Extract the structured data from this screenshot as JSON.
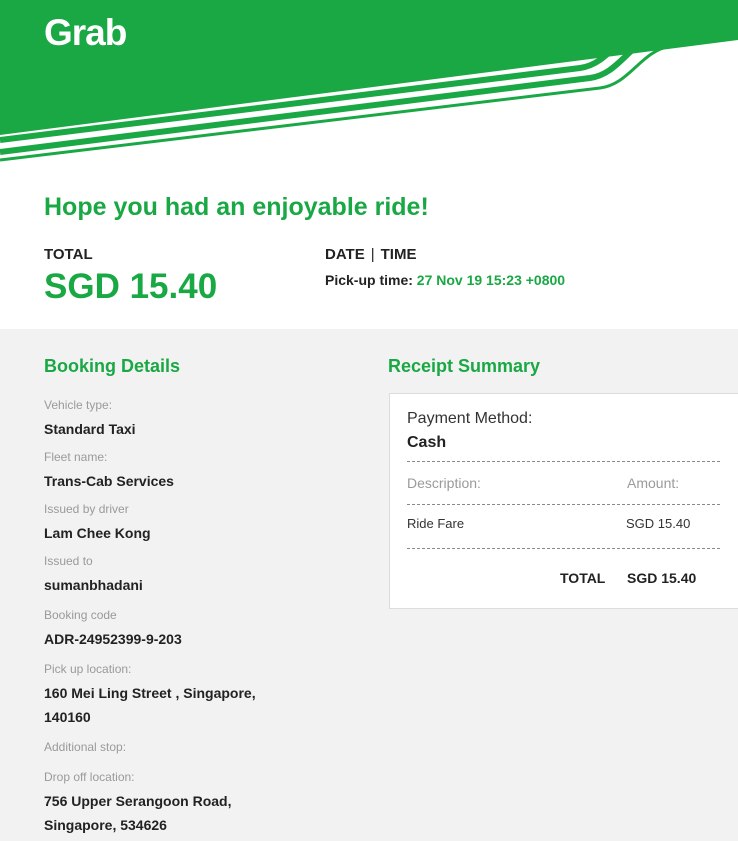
{
  "brand": {
    "name": "Grab",
    "color": "#1aa845"
  },
  "hero": {
    "headline": "Hope you had an enjoyable ride!",
    "total_label": "TOTAL",
    "total_value": "SGD 15.40",
    "date_label": "DATE",
    "time_label": "TIME",
    "date_separator": "|",
    "pickup_label": "Pick-up time:",
    "pickup_value": "27 Nov 19 15:23 +0800"
  },
  "booking": {
    "title": "Booking Details",
    "fields": [
      {
        "label": "Vehicle type:",
        "value": "Standard Taxi"
      },
      {
        "label": "Fleet name:",
        "value": "Trans-Cab Services"
      },
      {
        "label": "Issued by driver",
        "value": "Lam Chee Kong"
      },
      {
        "label": "Issued to",
        "value": "sumanbhadani"
      },
      {
        "label": "Booking code",
        "value": "ADR-24952399-9-203"
      },
      {
        "label": "Pick up location:",
        "value_line1": "160 Mei Ling Street , Singapore,",
        "value_line2": "140160"
      },
      {
        "label": "Additional stop:",
        "value": ""
      },
      {
        "label": "Drop off location:",
        "value_line1": "756 Upper Serangoon Road,",
        "value_line2": "Singapore, 534626"
      }
    ]
  },
  "receipt": {
    "title": "Receipt Summary",
    "payment_method_label": "Payment Method:",
    "payment_method_value": "Cash",
    "col_description": "Description:",
    "col_amount": "Amount:",
    "rows": [
      {
        "description": "Ride Fare",
        "amount": "SGD 15.40"
      }
    ],
    "total_label": "TOTAL",
    "total_value": "SGD 15.40"
  }
}
